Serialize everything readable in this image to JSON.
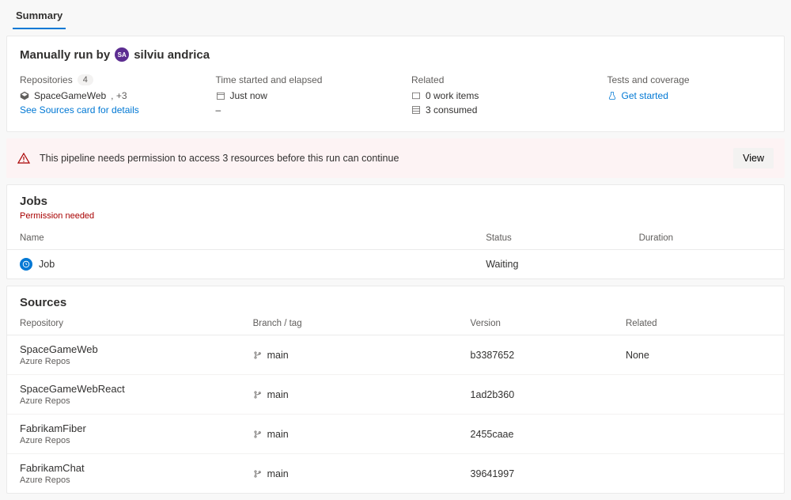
{
  "tab": "Summary",
  "run": {
    "prefix": "Manually run by",
    "avatar_initials": "SA",
    "user": "silviu andrica"
  },
  "repositories": {
    "label": "Repositories",
    "count": "4",
    "primary": "SpaceGameWeb",
    "extra": ", +3",
    "see_link": "See Sources card for details"
  },
  "time": {
    "label": "Time started and elapsed",
    "started": "Just now",
    "elapsed": "–"
  },
  "related": {
    "label": "Related",
    "work_items": "0 work items",
    "consumed": "3 consumed"
  },
  "tests": {
    "label": "Tests and coverage",
    "link": "Get started"
  },
  "alert": {
    "text": "This pipeline needs permission to access 3 resources before this run can continue",
    "button": "View"
  },
  "jobs": {
    "title": "Jobs",
    "permission": "Permission needed",
    "headers": {
      "name": "Name",
      "status": "Status",
      "duration": "Duration"
    },
    "rows": [
      {
        "name": "Job",
        "status": "Waiting",
        "duration": ""
      }
    ]
  },
  "sources": {
    "title": "Sources",
    "headers": {
      "repo": "Repository",
      "branch": "Branch / tag",
      "version": "Version",
      "related": "Related"
    },
    "rows": [
      {
        "name": "SpaceGameWeb",
        "sub": "Azure Repos",
        "branch": "main",
        "version": "b3387652",
        "related": "None"
      },
      {
        "name": "SpaceGameWebReact",
        "sub": "Azure Repos",
        "branch": "main",
        "version": "1ad2b360",
        "related": ""
      },
      {
        "name": "FabrikamFiber",
        "sub": "Azure Repos",
        "branch": "main",
        "version": "2455caae",
        "related": ""
      },
      {
        "name": "FabrikamChat",
        "sub": "Azure Repos",
        "branch": "main",
        "version": "39641997",
        "related": ""
      }
    ]
  }
}
